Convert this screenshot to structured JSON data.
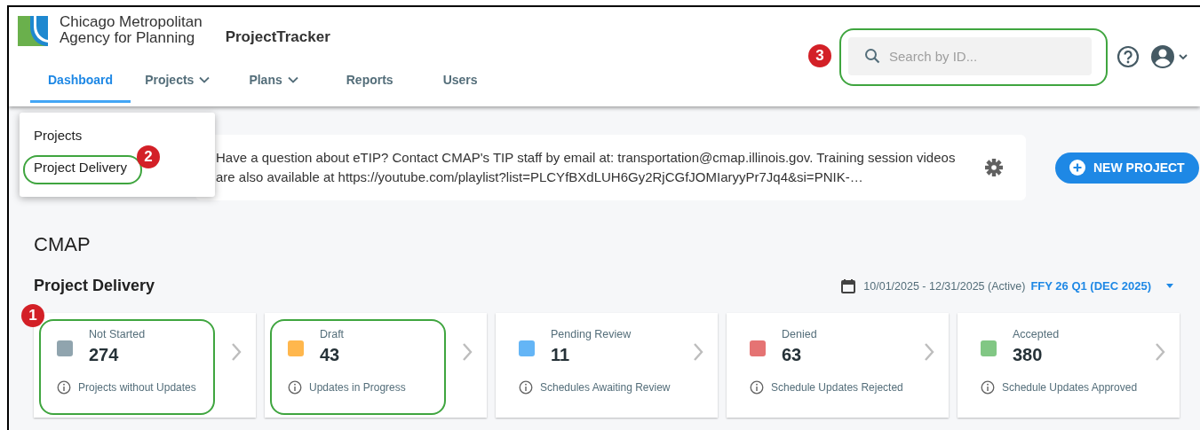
{
  "header": {
    "org_name": [
      "Chicago Metropolitan",
      "Agency for Planning"
    ],
    "app_name": "ProjectTracker"
  },
  "nav": [
    {
      "label": "Dashboard",
      "selected": true,
      "has_menu": false
    },
    {
      "label": "Projects",
      "selected": false,
      "has_menu": true
    },
    {
      "label": "Plans",
      "selected": false,
      "has_menu": true
    },
    {
      "label": "Reports",
      "selected": false,
      "has_menu": false
    },
    {
      "label": "Users",
      "selected": false,
      "has_menu": false
    }
  ],
  "search": {
    "placeholder": "Search by ID...",
    "highlighted": true,
    "annotation": "3"
  },
  "dropdown": [
    {
      "label": "Projects",
      "highlighted": false
    },
    {
      "label": "Project Delivery",
      "highlighted": true,
      "annotation": "2"
    }
  ],
  "announcement": "Have a question about eTIP? Contact CMAP's TIP staff by email at: transportation@cmap.illinois.gov. Training session videos are also available at https://youtube.com/playlist?list=PLCYfBXdLUH6Gy2RjCGfJOMIaryyPr7Jq4&si=PNIK-…",
  "new_project_button": "NEW PROJECT",
  "agency": "CMAP",
  "section_title": "Project Delivery",
  "date_range": "10/01/2025 - 12/31/2025 (Active)",
  "period": "FFY 26 Q1 (DEC 2025)",
  "cards": [
    {
      "label": "Not Started",
      "count": "274",
      "description": "Projects without Updates",
      "color": "#90a4ae",
      "highlighted": true,
      "annotation": "1"
    },
    {
      "label": "Draft",
      "count": "43",
      "description": "Updates in Progress",
      "color": "#ffb74d",
      "highlighted": true
    },
    {
      "label": "Pending Review",
      "count": "11",
      "description": "Schedules Awaiting Review",
      "color": "#64b5f6",
      "highlighted": false
    },
    {
      "label": "Denied",
      "count": "63",
      "description": "Schedule Updates Rejected",
      "color": "#e57373",
      "highlighted": false
    },
    {
      "label": "Accepted",
      "count": "380",
      "description": "Schedule Updates Approved",
      "color": "#81c784",
      "highlighted": false
    }
  ]
}
